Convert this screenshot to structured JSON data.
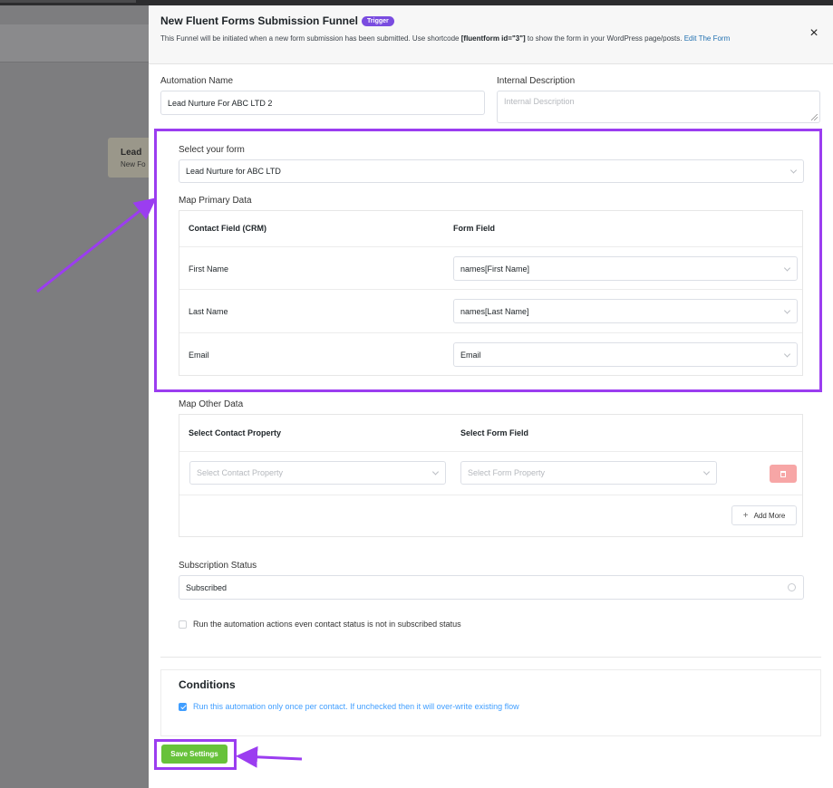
{
  "background": {
    "card_title": "Lead",
    "card_subtitle": "New Fo"
  },
  "drawer": {
    "title": "New Fluent Forms Submission Funnel",
    "badge": "Trigger",
    "desc_pre": "This Funnel will be initiated when a new form submission has been submitted. Use shortcode ",
    "desc_code": "[fluentform id=\"3\"]",
    "desc_post": " to show the form in your WordPress page/posts. ",
    "desc_link": "Edit The Form",
    "close_icon": "×"
  },
  "automation": {
    "name_label": "Automation Name",
    "name_value": "Lead Nurture For ABC LTD 2",
    "desc_label": "Internal Description",
    "desc_placeholder": "Internal Description"
  },
  "form_select": {
    "label": "Select your form",
    "value": "Lead Nurture for ABC LTD"
  },
  "primary_map": {
    "label": "Map Primary Data",
    "col_crm": "Contact Field (CRM)",
    "col_form": "Form Field",
    "rows": [
      {
        "crm": "First Name",
        "form": "names[First Name]"
      },
      {
        "crm": "Last Name",
        "form": "names[Last Name]"
      },
      {
        "crm": "Email",
        "form": "Email"
      }
    ]
  },
  "other_map": {
    "label": "Map Other Data",
    "col_contact": "Select Contact Property",
    "col_form": "Select Form Field",
    "contact_placeholder": "Select Contact Property",
    "form_placeholder": "Select Form Property",
    "add_more": "Add More",
    "add_icon": "+"
  },
  "subscription": {
    "label": "Subscription Status",
    "value": "Subscribed",
    "run_label": "Run the automation actions even contact status is not in subscribed status",
    "run_checked": false
  },
  "conditions": {
    "title": "Conditions",
    "once_label": "Run this automation only once per contact. If unchecked then it will over-write existing flow",
    "once_checked": true
  },
  "save_label": "Save Settings",
  "colors": {
    "highlight": "#9b3df0",
    "save": "#67c23a",
    "badge": "#7a4ce0",
    "link": "#2271b1",
    "checkbox": "#409eff"
  }
}
